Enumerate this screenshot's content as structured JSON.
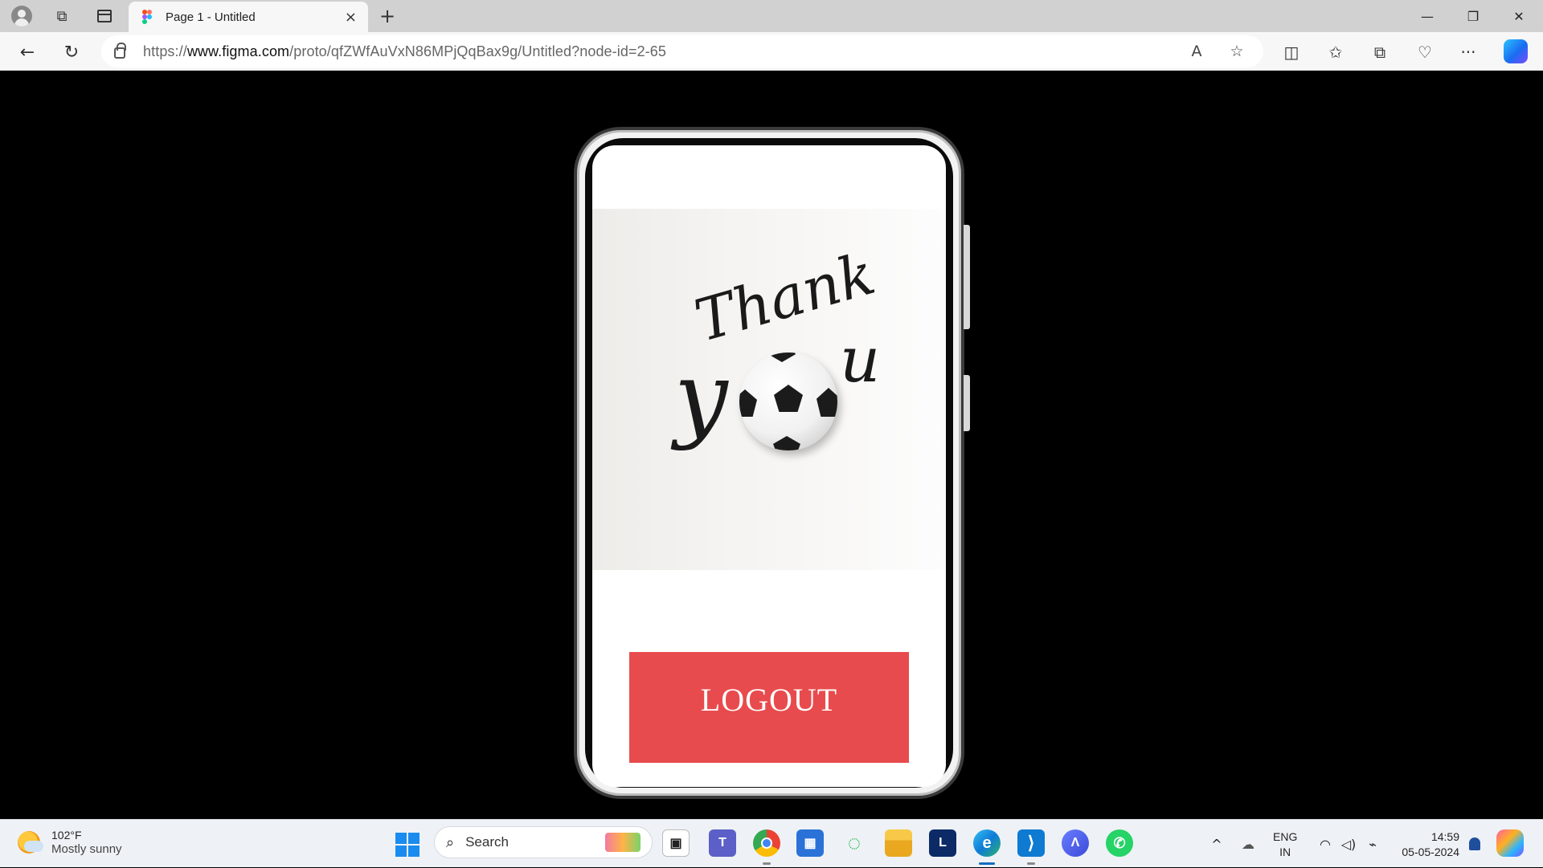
{
  "browser": {
    "tab_title": "Page 1 - Untitled",
    "tab_close": "×",
    "new_tab": "+",
    "url_prefix": "https://",
    "url_domain": "www.figma.com",
    "url_path": "/proto/qfZWfAuVxN86MPjQqBax9g/Untitled?node-id=2-65",
    "window_controls": {
      "minimize": "—",
      "restore": "❐",
      "close": "✕"
    },
    "nav": {
      "back": "←",
      "reload": "↻"
    },
    "url_actions": {
      "read_aloud": "A",
      "favorite": "☆"
    },
    "tools": {
      "split": "◫",
      "favorites": "✩",
      "collections": "⧉",
      "extensions": "♡",
      "more": "···"
    }
  },
  "prototype": {
    "image": {
      "line1": "Thank",
      "line2_start": "y",
      "line2_end": "u"
    },
    "logout_label": "LOGOUT"
  },
  "taskbar": {
    "weather_temp": "102°F",
    "weather_condition": "Mostly sunny",
    "search_placeholder": "Search",
    "search_icon": "⌕",
    "apps": [
      {
        "name": "task-view",
        "glyph": "▣"
      },
      {
        "name": "teams",
        "glyph": "T"
      },
      {
        "name": "chrome",
        "glyph": ""
      },
      {
        "name": "store",
        "glyph": "▦"
      },
      {
        "name": "circle-app",
        "glyph": "◌"
      },
      {
        "name": "file-explorer",
        "glyph": ""
      },
      {
        "name": "l-app",
        "glyph": "L"
      },
      {
        "name": "edge",
        "glyph": "e"
      },
      {
        "name": "vscode",
        "glyph": "⟩"
      },
      {
        "name": "arc-app",
        "glyph": "Λ"
      },
      {
        "name": "whatsapp",
        "glyph": "✆"
      }
    ],
    "tray_chevron": "^",
    "language_1": "ENG",
    "language_2": "IN",
    "time": "14:59",
    "date": "05-05-2024",
    "tray_icons": {
      "network": "☁",
      "wifi": "◠",
      "volume": "◁)",
      "battery": "⌁",
      "notifications": "♪"
    }
  },
  "colors": {
    "logout_button": "#e84b4d",
    "canvas_background": "#000000"
  }
}
